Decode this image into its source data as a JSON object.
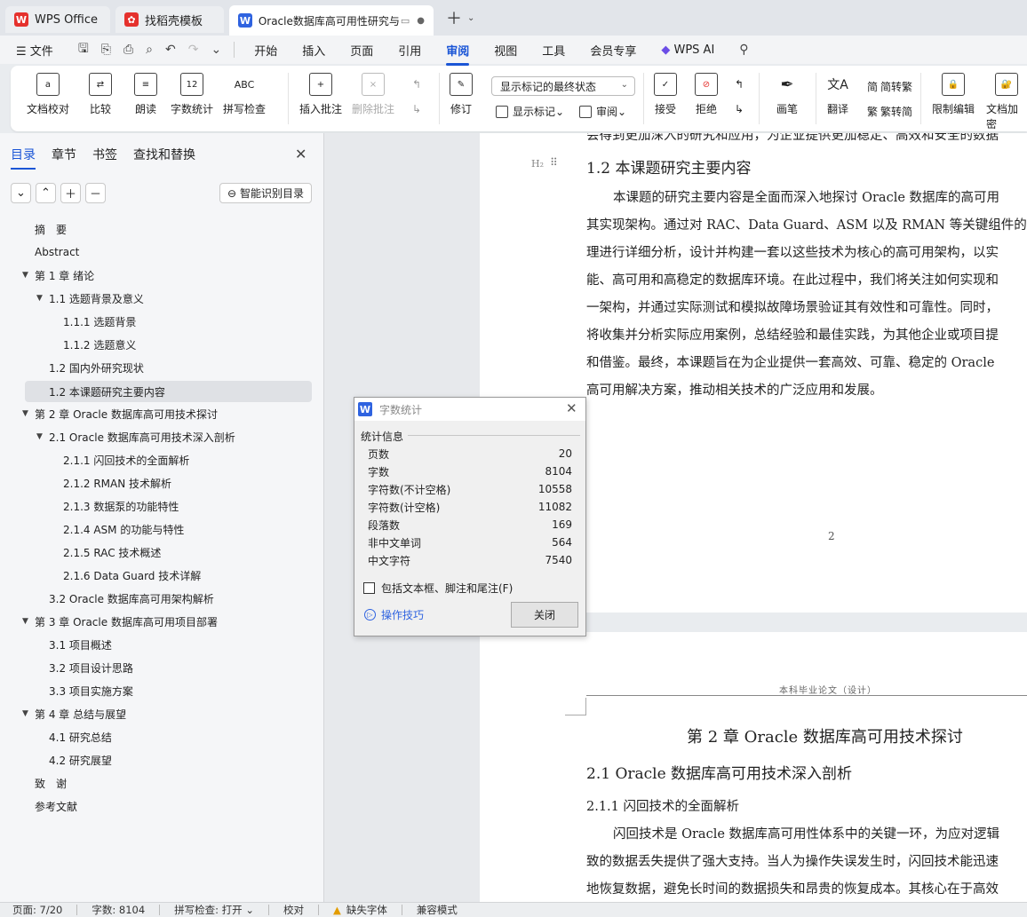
{
  "tabs": [
    {
      "label": "WPS Office",
      "icon": "wps-logo-icon"
    },
    {
      "label": "找稻壳模板",
      "icon": "docer-icon"
    },
    {
      "label": "Oracle数据库高可用性研究与实现",
      "icon": "word-doc-icon"
    }
  ],
  "menu": {
    "file": "文件",
    "items": [
      "开始",
      "插入",
      "页面",
      "引用",
      "审阅",
      "视图",
      "工具",
      "会员专享"
    ],
    "active": "审阅",
    "ai": "WPS AI"
  },
  "ribbon": {
    "proofread": "文档校对",
    "compare": "比较",
    "read_aloud": "朗读",
    "word_count": "字数统计",
    "spell_check": "拼写检查",
    "insert_comment": "插入批注",
    "delete_comment": "删除批注",
    "revise": "修订",
    "markup_select": "显示标记的最终状态",
    "show_markup": "显示标记",
    "review": "审阅",
    "accept": "接受",
    "reject": "拒绝",
    "pen": "画笔",
    "translate": "翻译",
    "to_traditional": "简转繁",
    "to_simplified": "繁转简",
    "restrict_edit": "限制编辑",
    "doc_encrypt": "文档加密"
  },
  "panel": {
    "tabs": [
      "目录",
      "章节",
      "书签",
      "查找和替换"
    ],
    "smart_toc": "智能识别目录",
    "toc": [
      {
        "text": "摘　要"
      },
      {
        "text": "Abstract"
      },
      {
        "text": "第 1 章  绪论"
      },
      {
        "text": "1.1  选题背景及意义"
      },
      {
        "text": "1.1.1  选题背景"
      },
      {
        "text": "1.1.2  选题意义"
      },
      {
        "text": "1.2  国内外研究现状"
      },
      {
        "text": "1.2 本课题研究主要内容"
      },
      {
        "text": "第 2 章  Oracle 数据库高可用技术探讨"
      },
      {
        "text": "2.1 Oracle 数据库高可用技术深入剖析"
      },
      {
        "text": "2.1.1  闪回技术的全面解析"
      },
      {
        "text": "2.1.2 RMAN 技术解析"
      },
      {
        "text": "2.1.3  数据泵的功能特性"
      },
      {
        "text": "2.1.4 ASM 的功能与特性"
      },
      {
        "text": "2.1.5 RAC 技术概述"
      },
      {
        "text": "2.1.6 Data Guard 技术详解"
      },
      {
        "text": "3.2 Oracle 数据库高可用架构解析"
      },
      {
        "text": "第 3 章  Oracle 数据库高可用项目部署"
      },
      {
        "text": "3.1  项目概述"
      },
      {
        "text": "3.2  项目设计思路"
      },
      {
        "text": "3.3  项目实施方案"
      },
      {
        "text": "第 4 章  总结与展望"
      },
      {
        "text": "4.1  研究总结"
      },
      {
        "text": "4.2  研究展望"
      },
      {
        "text": "致　谢"
      },
      {
        "text": "参考文献"
      }
    ]
  },
  "document": {
    "top_cut": "会得到更加深入的研究和应用，为企业提供更加稳定、高效和安全的数据",
    "heading_marker": "H₂",
    "heading": "1.2 本课题研究主要内容",
    "paragraph": [
      "本课题的研究主要内容是全面而深入地探讨 Oracle 数据库的高可用",
      "其实现架构。通过对 RAC、Data Guard、ASM 以及 RMAN 等关键组件的",
      "理进行详细分析，设计并构建一套以这些技术为核心的高可用架构，以实",
      "能、高可用和高稳定的数据库环境。在此过程中，我们将关注如何实现和",
      "一架构，并通过实际测试和模拟故障场景验证其有效性和可靠性。同时，",
      "将收集并分析实际应用案例，总结经验和最佳实践，为其他企业或项目提",
      "和借鉴。最终，本课题旨在为企业提供一套高效、可靠、稳定的 Oracle",
      "高可用解决方案，推动相关技术的广泛应用和发展。"
    ],
    "page_number": "2",
    "page2_header": "本科毕业论文（设计）",
    "chapter_title": "第 2 章  Oracle 数据库高可用技术探讨",
    "section_title": "2.1 Oracle 数据库高可用技术深入剖析",
    "subsection_title": "2.1.1  闪回技术的全面解析",
    "page2_paragraph": [
      "闪回技术是 Oracle 数据库高可用性体系中的关键一环，为应对逻辑",
      "致的数据丢失提供了强大支持。当人为操作失误发生时，闪回技术能迅速",
      "地恢复数据，避免长时间的数据损失和昂贵的恢复成本。其核心在于高效"
    ]
  },
  "dialog": {
    "title": "字数统计",
    "group": "统计信息",
    "stats": [
      {
        "label": "页数",
        "value": "20"
      },
      {
        "label": "字数",
        "value": "8104"
      },
      {
        "label": "字符数(不计空格)",
        "value": "10558"
      },
      {
        "label": "字符数(计空格)",
        "value": "11082"
      },
      {
        "label": "段落数",
        "value": "169"
      },
      {
        "label": "非中文单词",
        "value": "564"
      },
      {
        "label": "中文字符",
        "value": "7540"
      }
    ],
    "include_label": "包括文本框、脚注和尾注(F)",
    "tips": "操作技巧",
    "close": "关闭"
  },
  "status": {
    "page": "页面: 7/20",
    "words": "字数: 8104",
    "spell": "拼写检查: 打开",
    "proof": "校对",
    "missing_font": "缺失字体",
    "compat": "兼容模式"
  },
  "colors": {
    "accent": "#1a55d6",
    "wps_red": "#e5312d",
    "word_blue": "#2f63e0"
  }
}
